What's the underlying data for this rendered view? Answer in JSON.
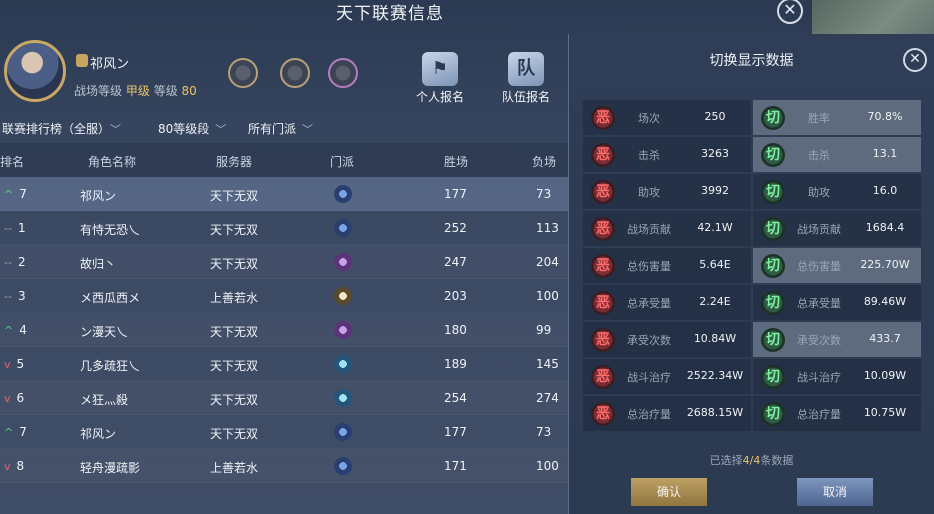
{
  "window": {
    "title": "天下联赛信息",
    "close_glyph": "✕"
  },
  "profile": {
    "name": "祁风ン",
    "level_label": "战场等级",
    "grade": "甲级",
    "level_text": "等级",
    "level_value": "80"
  },
  "actions": {
    "personal_signup": "个人报名",
    "team_signup": "队伍报名",
    "team_icon_text": "队"
  },
  "filters": [
    {
      "label": "联赛排行榜（全服）"
    },
    {
      "label": "80等级段"
    },
    {
      "label": "所有门派"
    }
  ],
  "table": {
    "headers": [
      "排名",
      "角色名称",
      "服务器",
      "门派",
      "胜场",
      "负场"
    ],
    "rows": [
      {
        "trend": "up",
        "trend_glyph": "^",
        "rank": "7",
        "name": "祁风ン",
        "server": "天下无双",
        "sect": "blue",
        "wins": "177",
        "losses": "73",
        "highlight": true
      },
      {
        "trend": "flat",
        "trend_glyph": "--",
        "rank": "1",
        "name": "有恃无恐乀",
        "server": "天下无双",
        "sect": "blue",
        "wins": "252",
        "losses": "113"
      },
      {
        "trend": "flat",
        "trend_glyph": "--",
        "rank": "2",
        "name": "故归丶",
        "server": "天下无双",
        "sect": "purple",
        "wins": "247",
        "losses": "204"
      },
      {
        "trend": "flat",
        "trend_glyph": "--",
        "rank": "3",
        "name": "メ西瓜西メ",
        "server": "上善若水",
        "sect": "gold",
        "wins": "203",
        "losses": "100"
      },
      {
        "trend": "up",
        "trend_glyph": "^",
        "rank": "4",
        "name": "ン漫天乀",
        "server": "天下无双",
        "sect": "purple",
        "wins": "180",
        "losses": "99"
      },
      {
        "trend": "down",
        "trend_glyph": "v",
        "rank": "5",
        "name": "几多疏狂乀",
        "server": "天下无双",
        "sect": "cyan",
        "wins": "189",
        "losses": "145"
      },
      {
        "trend": "down",
        "trend_glyph": "v",
        "rank": "6",
        "name": "メ狂灬殺",
        "server": "天下无双",
        "sect": "cyan",
        "wins": "254",
        "losses": "274"
      },
      {
        "trend": "up",
        "trend_glyph": "^",
        "rank": "7",
        "name": "祁风ン",
        "server": "天下无双",
        "sect": "blue",
        "wins": "177",
        "losses": "73"
      },
      {
        "trend": "down",
        "trend_glyph": "v",
        "rank": "8",
        "name": "轻舟漫疏影",
        "server": "上善若水",
        "sect": "blue",
        "wins": "171",
        "losses": "100"
      }
    ]
  },
  "panel": {
    "title": "切换显示数据",
    "close_glyph": "✕",
    "red_icon_text": "恶",
    "green_icon_text": "切",
    "left": [
      {
        "label": "场次",
        "value": "250"
      },
      {
        "label": "击杀",
        "value": "3263"
      },
      {
        "label": "助攻",
        "value": "3992"
      },
      {
        "label": "战场贡献",
        "value": "42.1W"
      },
      {
        "label": "总伤害量",
        "value": "5.64E"
      },
      {
        "label": "总承受量",
        "value": "2.24E"
      },
      {
        "label": "承受次数",
        "value": "10.84W"
      },
      {
        "label": "战斗治疗",
        "value": "2522.34W"
      },
      {
        "label": "总治疗量",
        "value": "2688.15W"
      }
    ],
    "right": [
      {
        "label": "胜率",
        "value": "70.8%",
        "selected": true
      },
      {
        "label": "击杀",
        "value": "13.1",
        "selected": true
      },
      {
        "label": "助攻",
        "value": "16.0",
        "selected": false
      },
      {
        "label": "战场贡献",
        "value": "1684.4",
        "selected": false
      },
      {
        "label": "总伤害量",
        "value": "225.70W",
        "selected": true
      },
      {
        "label": "总承受量",
        "value": "89.46W",
        "selected": false
      },
      {
        "label": "承受次数",
        "value": "433.7",
        "selected": true
      },
      {
        "label": "战斗治疗",
        "value": "10.09W",
        "selected": false
      },
      {
        "label": "总治疗量",
        "value": "10.75W",
        "selected": false
      }
    ],
    "selected_prefix": "已选择",
    "selected_count": "4/4",
    "selected_suffix": "条数据",
    "confirm": "确认",
    "cancel": "取消"
  }
}
